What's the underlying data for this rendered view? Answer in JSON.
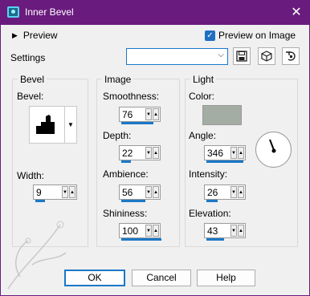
{
  "window": {
    "title": "Inner Bevel",
    "close_glyph": "✕"
  },
  "preview": {
    "label": "Preview",
    "checkbox_label": "Preview on Image",
    "checked": true
  },
  "settings": {
    "label": "Settings",
    "value": ""
  },
  "groups": {
    "bevel": {
      "title": "Bevel",
      "bevel_label": "Bevel:",
      "width_label": "Width:",
      "width_value": "9"
    },
    "image": {
      "title": "Image",
      "smoothness_label": "Smoothness:",
      "smoothness_value": "76",
      "depth_label": "Depth:",
      "depth_value": "22",
      "ambience_label": "Ambience:",
      "ambience_value": "56",
      "shininess_label": "Shininess:",
      "shininess_value": "100"
    },
    "light": {
      "title": "Light",
      "color_label": "Color:",
      "color": "#a3ada3",
      "angle_label": "Angle:",
      "angle_value": "346",
      "intensity_label": "Intensity:",
      "intensity_value": "26",
      "elevation_label": "Elevation:",
      "elevation_value": "43"
    }
  },
  "buttons": {
    "ok": "OK",
    "cancel": "Cancel",
    "help": "Help"
  },
  "icons": [
    "save-preset-icon",
    "resource-icon",
    "reset-icon"
  ]
}
